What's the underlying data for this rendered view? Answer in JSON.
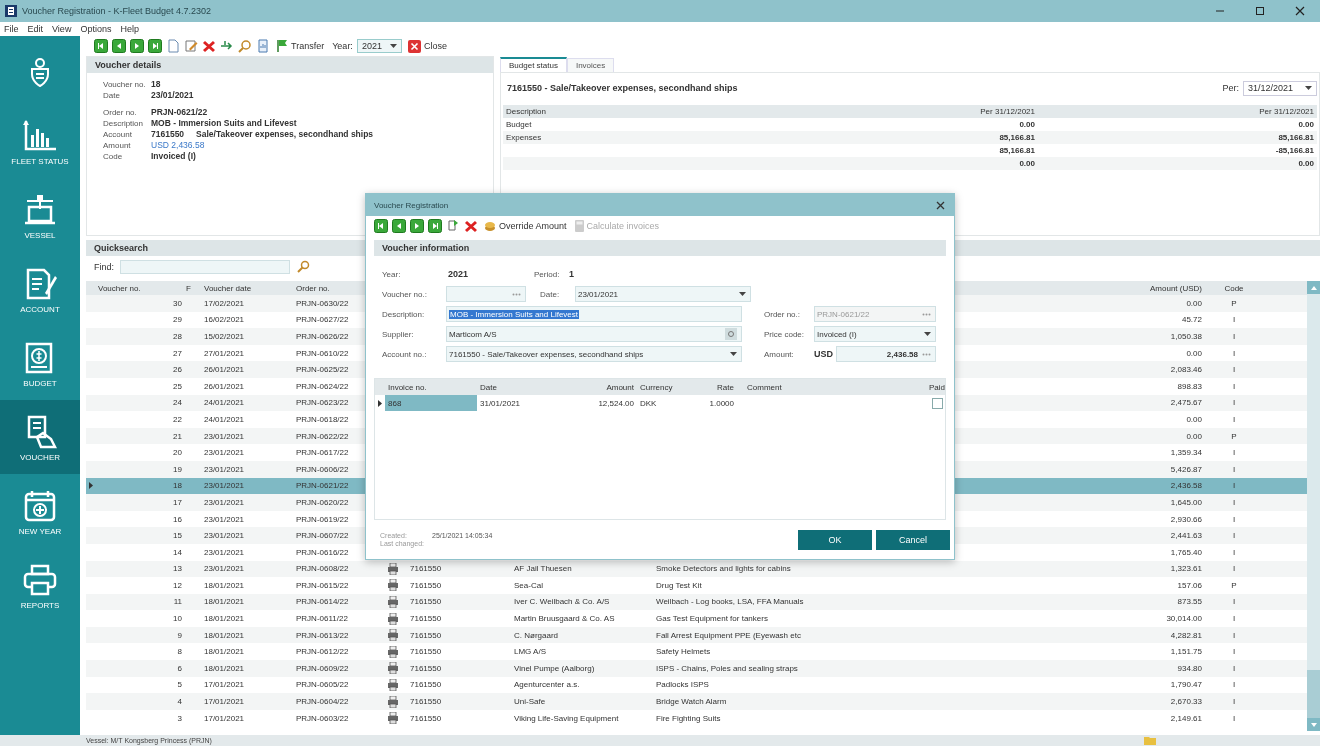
{
  "window": {
    "title": "Voucher Registration - K-Fleet Budget 4.7.2302"
  },
  "menu": [
    "File",
    "Edit",
    "View",
    "Options",
    "Help"
  ],
  "toolbar": {
    "transfer_label": "Transfer",
    "year_label": "Year:",
    "year_value": "2021",
    "close_label": "Close"
  },
  "sidebar": {
    "items": [
      {
        "kind": "crest"
      },
      {
        "kind": "chart",
        "label": "FLEET STATUS",
        "selected": false
      },
      {
        "kind": "ship",
        "label": "VESSEL",
        "selected": false
      },
      {
        "kind": "account",
        "label": "ACCOUNT",
        "selected": false
      },
      {
        "kind": "budget",
        "label": "BUDGET",
        "selected": false
      },
      {
        "kind": "voucher",
        "label": "VOUCHER",
        "selected": true
      },
      {
        "kind": "calendar",
        "label": "NEW YEAR",
        "selected": false
      },
      {
        "kind": "printer",
        "label": "REPORTS",
        "selected": false
      }
    ]
  },
  "voucher_details": {
    "title": "Voucher details",
    "groups": [
      [
        {
          "label": "Voucher no.",
          "value": "18"
        },
        {
          "label": "Date",
          "value": "23/01/2021"
        }
      ],
      [
        {
          "label": "Order no.",
          "value": "PRJN-0621/22"
        },
        {
          "label": "Description",
          "value": "MOB - Immersion Suits and Lifevest"
        },
        {
          "label": "Account",
          "value": "7161550",
          "extra": "Sale/Takeover expenses, secondhand ships"
        },
        {
          "label": "Amount",
          "value": "USD 2,436.58",
          "kind": "amount"
        },
        {
          "label": "Code",
          "value": "Invoiced (I)"
        }
      ]
    ]
  },
  "budget_panel": {
    "tabs": [
      {
        "label": "Budget status",
        "selected": true
      },
      {
        "label": "Invoices",
        "selected": false
      }
    ],
    "heading": "7161550 - Sale/Takeover expenses, secondhand ships",
    "per_label": "Per:",
    "per_value": "31/12/2021",
    "columns": [
      "Description",
      "Per 31/12/2021",
      "Per 31/12/2021"
    ],
    "rows": [
      {
        "description": "Budget",
        "values": [
          "0.00",
          "0.00"
        ]
      },
      {
        "description": "Expenses",
        "values": [
          "85,166.81",
          "85,166.81"
        ]
      },
      {
        "values": [
          "85,166.81",
          "-85,166.81"
        ]
      },
      {
        "values": [
          "0.00",
          "0.00"
        ]
      }
    ]
  },
  "quicksearch": {
    "title": "Quicksearch",
    "find_label": "Find:"
  },
  "vouchers": {
    "columns": {
      "voucher_no": "Voucher no.",
      "flag": "F",
      "date": "Voucher date",
      "order_no": "Order no.",
      "amount": "Amount (USD)",
      "code": "Code"
    },
    "rows": [
      {
        "selected": false,
        "voucher_no": "30",
        "date": "17/02/2021",
        "order_no": "PRJN-0630/22",
        "amount": "0.00",
        "code": "P"
      },
      {
        "selected": false,
        "voucher_no": "29",
        "date": "16/02/2021",
        "order_no": "PRJN-0627/22",
        "amount": "45.72",
        "code": "I"
      },
      {
        "selected": false,
        "voucher_no": "28",
        "date": "15/02/2021",
        "order_no": "PRJN-0626/22",
        "amount": "1,050.38",
        "code": "I"
      },
      {
        "selected": false,
        "voucher_no": "27",
        "date": "27/01/2021",
        "order_no": "PRJN-0610/22",
        "amount": "0.00",
        "code": "I"
      },
      {
        "selected": false,
        "voucher_no": "26",
        "date": "26/01/2021",
        "order_no": "PRJN-0625/22",
        "amount": "2,083.46",
        "code": "I"
      },
      {
        "selected": false,
        "voucher_no": "25",
        "date": "26/01/2021",
        "order_no": "PRJN-0624/22",
        "amount": "898.83",
        "code": "I"
      },
      {
        "selected": false,
        "voucher_no": "24",
        "date": "24/01/2021",
        "order_no": "PRJN-0623/22",
        "amount": "2,475.67",
        "code": "I"
      },
      {
        "selected": false,
        "voucher_no": "22",
        "date": "24/01/2021",
        "order_no": "PRJN-0618/22",
        "amount": "0.00",
        "code": "I"
      },
      {
        "selected": false,
        "voucher_no": "21",
        "date": "23/01/2021",
        "order_no": "PRJN-0622/22",
        "amount": "0.00",
        "code": "P"
      },
      {
        "selected": false,
        "voucher_no": "20",
        "date": "23/01/2021",
        "order_no": "PRJN-0617/22",
        "amount": "1,359.34",
        "code": "I"
      },
      {
        "selected": false,
        "voucher_no": "19",
        "date": "23/01/2021",
        "order_no": "PRJN-0606/22",
        "amount": "5,426.87",
        "code": "I"
      },
      {
        "selected": true,
        "voucher_no": "18",
        "date": "23/01/2021",
        "order_no": "PRJN-0621/22",
        "amount": "2,436.58",
        "code": "I"
      },
      {
        "selected": false,
        "voucher_no": "17",
        "date": "23/01/2021",
        "order_no": "PRJN-0620/22",
        "amount": "1,645.00",
        "code": "I"
      },
      {
        "selected": false,
        "voucher_no": "16",
        "date": "23/01/2021",
        "order_no": "PRJN-0619/22",
        "amount": "2,930.66",
        "code": "I"
      },
      {
        "selected": false,
        "voucher_no": "15",
        "date": "23/01/2021",
        "order_no": "PRJN-0607/22",
        "amount": "2,441.63",
        "code": "I"
      },
      {
        "selected": false,
        "voucher_no": "14",
        "date": "23/01/2021",
        "order_no": "PRJN-0616/22",
        "amount": "1,765.40",
        "code": "I"
      },
      {
        "selected": false,
        "voucher_no": "13",
        "date": "23/01/2021",
        "order_no": "PRJN-0608/22",
        "account": "7161550",
        "supplier": "AF Jail Thuesen",
        "description": "Smoke Detectors and lights for cabins",
        "amount": "1,323.61",
        "code": "I"
      },
      {
        "selected": false,
        "voucher_no": "12",
        "date": "18/01/2021",
        "order_no": "PRJN-0615/22",
        "account": "7161550",
        "supplier": "Sea-Cal",
        "description": "Drug Test Kit",
        "amount": "157.06",
        "code": "P"
      },
      {
        "selected": false,
        "voucher_no": "11",
        "date": "18/01/2021",
        "order_no": "PRJN-0614/22",
        "account": "7161550",
        "supplier": "Iver C. Weilbach & Co. A/S",
        "description": "Weilbach - Log books, LSA, FFA Manuals",
        "amount": "873.55",
        "code": "I"
      },
      {
        "selected": false,
        "voucher_no": "10",
        "date": "18/01/2021",
        "order_no": "PRJN-0611/22",
        "account": "7161550",
        "supplier": "Martin Bruusgaard & Co. AS",
        "description": "Gas Test Equipment for tankers",
        "amount": "30,014.00",
        "code": "I"
      },
      {
        "selected": false,
        "voucher_no": "9",
        "date": "18/01/2021",
        "order_no": "PRJN-0613/22",
        "account": "7161550",
        "supplier": "C. Nørgaard",
        "description": "Fall Arrest Equipment PPE (Eyewash etc",
        "amount": "4,282.81",
        "code": "I"
      },
      {
        "selected": false,
        "voucher_no": "8",
        "date": "18/01/2021",
        "order_no": "PRJN-0612/22",
        "account": "7161550",
        "supplier": "LMG A/S",
        "description": "Safety Helmets",
        "amount": "1,151.75",
        "code": "I"
      },
      {
        "selected": false,
        "voucher_no": "6",
        "date": "18/01/2021",
        "order_no": "PRJN-0609/22",
        "account": "7161550",
        "supplier": "Vinel Pumpe (Aalborg)",
        "description": "ISPS - Chains, Poles and sealing straps",
        "amount": "934.80",
        "code": "I"
      },
      {
        "selected": false,
        "voucher_no": "5",
        "date": "17/01/2021",
        "order_no": "PRJN-0605/22",
        "account": "7161550",
        "supplier": "Agenturcenter a.s.",
        "description": "Padlocks ISPS",
        "amount": "1,790.47",
        "code": "I"
      },
      {
        "selected": false,
        "voucher_no": "4",
        "date": "17/01/2021",
        "order_no": "PRJN-0604/22",
        "account": "7161550",
        "supplier": "Uni-Safe",
        "description": "Bridge Watch Alarm",
        "amount": "2,670.33",
        "code": "I"
      },
      {
        "selected": false,
        "voucher_no": "3",
        "date": "17/01/2021",
        "order_no": "PRJN-0603/22",
        "account": "7161550",
        "supplier": "Viking Life-Saving Equipment",
        "description": "Fire Fighting Suits",
        "amount": "2,149.61",
        "code": "I"
      }
    ]
  },
  "status_bar": {
    "text": "Vessel: M/T Kongsberg Princess (PRJN)"
  },
  "dialog": {
    "title": "Voucher Registration",
    "override_label": "Override Amount",
    "calculate_label": "Calculate invoices",
    "calculate_disabled": true,
    "section_title": "Voucher information",
    "year_label": "Year:",
    "year": "2021",
    "period_label": "Period:",
    "period": "1",
    "voucher_no": {
      "label": "Voucher no.:"
    },
    "date": {
      "label": "Date:",
      "value": "23/01/2021"
    },
    "description": {
      "label": "Description:",
      "value": "MOB - Immersion Suits and Lifevest",
      "text_selected": true
    },
    "order_no": {
      "label": "Order no.:",
      "value": "PRJN-0621/22",
      "disabled": true
    },
    "supplier": {
      "label": "Supplier:",
      "value": "Marticom A/S"
    },
    "price_code": {
      "label": "Price code:",
      "value": "Invoiced (I)"
    },
    "account_no": {
      "label": "Account no.:",
      "value": "7161550 - Sale/Takeover expenses, secondhand ships"
    },
    "amount": {
      "label": "Amount:",
      "currency": "USD",
      "value": "2,436.58"
    },
    "invoices": {
      "columns": [
        "Invoice no.",
        "Date",
        "Amount",
        "Currency",
        "Rate",
        "Comment",
        "Paid"
      ],
      "rows": [
        {
          "selected": true,
          "invoice_no": "868",
          "date": "31/01/2021",
          "amount": "12,524.00",
          "currency": "DKK",
          "rate": "1.0000",
          "paid": false
        }
      ]
    },
    "created_label": "Created:",
    "created_value": "25/1/2021 14:05:34",
    "changed_label": "Last changed:",
    "buttons": [
      "OK",
      "Cancel"
    ]
  }
}
